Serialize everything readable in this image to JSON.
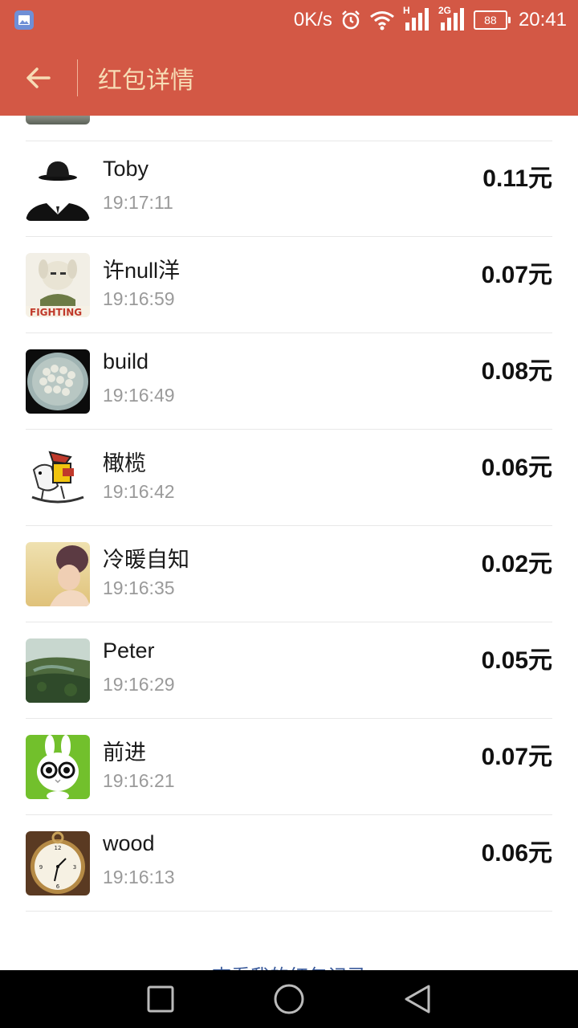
{
  "status_bar": {
    "net_speed": "0K/s",
    "network_h": "H",
    "network_2g": "2G",
    "battery": "88",
    "time": "20:41"
  },
  "header": {
    "title": "红包详情"
  },
  "records": [
    {
      "name": "Toby",
      "time": "19:17:11",
      "amount": "0.11元",
      "avatar": "hat-suit"
    },
    {
      "name": "许null洋",
      "time": "19:16:59",
      "amount": "0.07元",
      "avatar": "cartoon-fighting"
    },
    {
      "name": "build",
      "time": "19:16:49",
      "amount": "0.08元",
      "avatar": "dumplings"
    },
    {
      "name": "橄榄",
      "time": "19:16:42",
      "amount": "0.06元",
      "avatar": "cartoon-horse"
    },
    {
      "name": "冷暖自知",
      "time": "19:16:35",
      "amount": "0.02元",
      "avatar": "girl-field"
    },
    {
      "name": "Peter",
      "time": "19:16:29",
      "amount": "0.05元",
      "avatar": "landscape"
    },
    {
      "name": "前进",
      "time": "19:16:21",
      "amount": "0.07元",
      "avatar": "rabbit-glasses"
    },
    {
      "name": "wood",
      "time": "19:16:13",
      "amount": "0.06元",
      "avatar": "pocket-watch"
    }
  ],
  "footer": {
    "link": "查看我的红包记录"
  },
  "colors": {
    "header_bg": "#d35845",
    "title_text": "#f7dcb5",
    "divider": "#e8e8e8",
    "time_text": "#9a9a9a"
  }
}
